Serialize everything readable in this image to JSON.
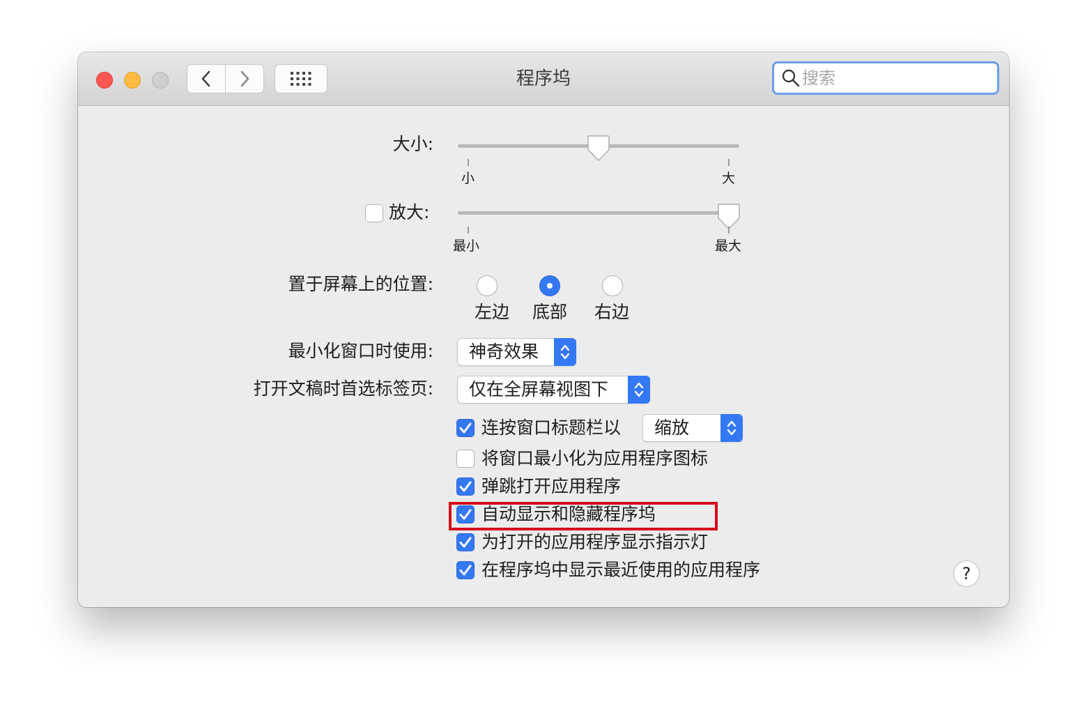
{
  "window": {
    "title": "程序坞",
    "search_placeholder": "搜索"
  },
  "icons": [
    "close-button",
    "minimize-button",
    "zoom-button",
    "chevron-left-icon",
    "chevron-right-icon",
    "grid-icon",
    "search-icon",
    "checkmark-icon",
    "updown-chevron-icon"
  ],
  "colors": {
    "accent": "#3478f6",
    "highlight": "#d40b1a"
  },
  "size": {
    "label": "大小:",
    "min_label": "小",
    "max_label": "大",
    "value_fraction": 0.5
  },
  "magnification": {
    "label": "放大:",
    "checked": false,
    "min_label": "最小",
    "max_label": "最大",
    "value_fraction": 1.0
  },
  "position": {
    "label": "置于屏幕上的位置:",
    "options": [
      {
        "label": "左边",
        "selected": false
      },
      {
        "label": "底部",
        "selected": true
      },
      {
        "label": "右边",
        "selected": false
      }
    ]
  },
  "minimize_effect": {
    "label": "最小化窗口时使用:",
    "value": "神奇效果"
  },
  "prefer_tabs": {
    "label": "打开文稿时首选标签页:",
    "value": "仅在全屏幕视图下"
  },
  "double_click": {
    "label": "连按窗口标题栏以",
    "checked": true,
    "value": "缩放"
  },
  "options": [
    {
      "label": "将窗口最小化为应用程序图标",
      "checked": false
    },
    {
      "label": "弹跳打开应用程序",
      "checked": true
    },
    {
      "label": "自动显示和隐藏程序坞",
      "checked": true,
      "highlighted": true
    },
    {
      "label": "为打开的应用程序显示指示灯",
      "checked": true
    },
    {
      "label": "在程序坞中显示最近使用的应用程序",
      "checked": true
    }
  ],
  "help": {
    "label": "?"
  }
}
